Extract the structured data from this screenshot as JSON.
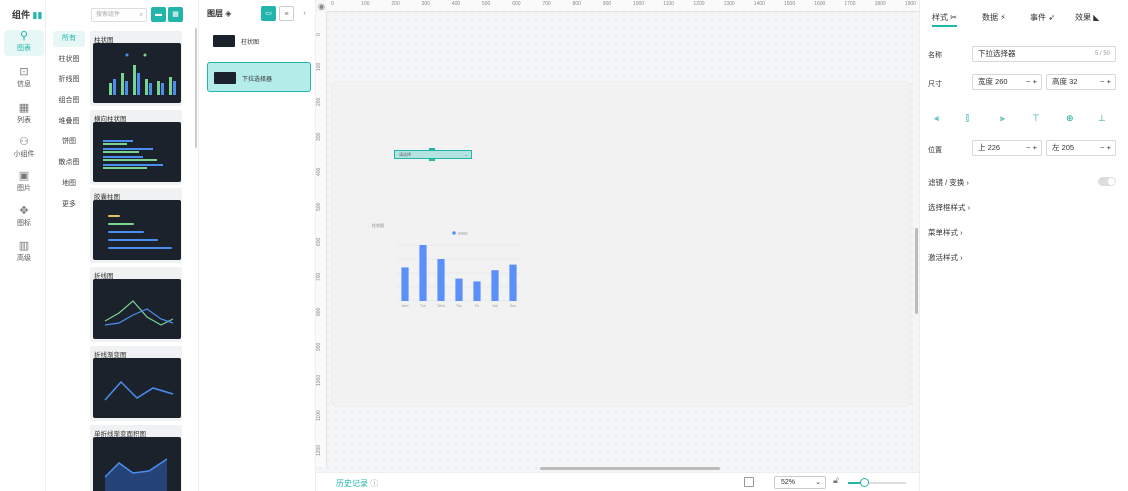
{
  "rail": {
    "title": "组件",
    "items": [
      {
        "label": "图表",
        "icon": "chart-icon"
      },
      {
        "label": "信息",
        "icon": "info-icon"
      },
      {
        "label": "列表",
        "icon": "list-icon"
      },
      {
        "label": "小组件",
        "icon": "widget-icon"
      },
      {
        "label": "图片",
        "icon": "image-icon"
      },
      {
        "label": "图标",
        "icon": "icons-icon"
      },
      {
        "label": "高级",
        "icon": "advanced-icon"
      }
    ]
  },
  "categories": [
    "所有",
    "柱状图",
    "折线图",
    "组合图",
    "堆叠图",
    "饼图",
    "散点图",
    "地图",
    "更多"
  ],
  "search": {
    "placeholder": "搜索组件"
  },
  "thumbnails": [
    "柱状图",
    "横向柱状图",
    "胶囊柱图",
    "折线图",
    "折线渐变图",
    "单折线渐变面积图"
  ],
  "layers": {
    "title": "图层",
    "items": [
      {
        "label": "柱状图",
        "selected": false
      },
      {
        "label": "下拉选择器",
        "selected": true
      }
    ]
  },
  "ruler": {
    "h": [
      "0",
      "100",
      "200",
      "300",
      "400",
      "500",
      "600",
      "700",
      "800",
      "900",
      "1000",
      "1100",
      "1200",
      "1300",
      "1400",
      "1500",
      "1600",
      "1700",
      "1800",
      "1900"
    ],
    "v": [
      "0",
      "100",
      "200",
      "300",
      "400",
      "500",
      "600",
      "700",
      "800",
      "900",
      "1000",
      "1100",
      "1200"
    ]
  },
  "canvas_chart": {
    "title": "柱状图",
    "legend": "data1",
    "categories": [
      "Mon",
      "Tue",
      "Wed",
      "Thu",
      "Fri",
      "Sat",
      "Sun"
    ],
    "values": [
      120,
      200,
      150,
      80,
      70,
      110,
      130
    ],
    "ymax": 200,
    "bar_color": "#5b8ff9"
  },
  "select_widget": {
    "text": "请选择"
  },
  "bottom": {
    "history": "历史记录",
    "zoom": "52%"
  },
  "props": {
    "tabs": [
      "样式",
      "数据",
      "事件",
      "效果"
    ],
    "name_label": "名称",
    "name_value": "下拉选择器",
    "name_count": "5 / 50",
    "size_label": "尺寸",
    "width": "宽度 260",
    "height": "高度 32",
    "pos_label": "位置",
    "top": "上 226",
    "left": "左 205",
    "sections": [
      "滤镜 / 变换",
      "选择框样式",
      "菜单样式",
      "激活样式"
    ]
  },
  "colors": {
    "accent": "#21b5ab",
    "board": "#f2f2f3",
    "dark_thumb": "#1c222c"
  }
}
